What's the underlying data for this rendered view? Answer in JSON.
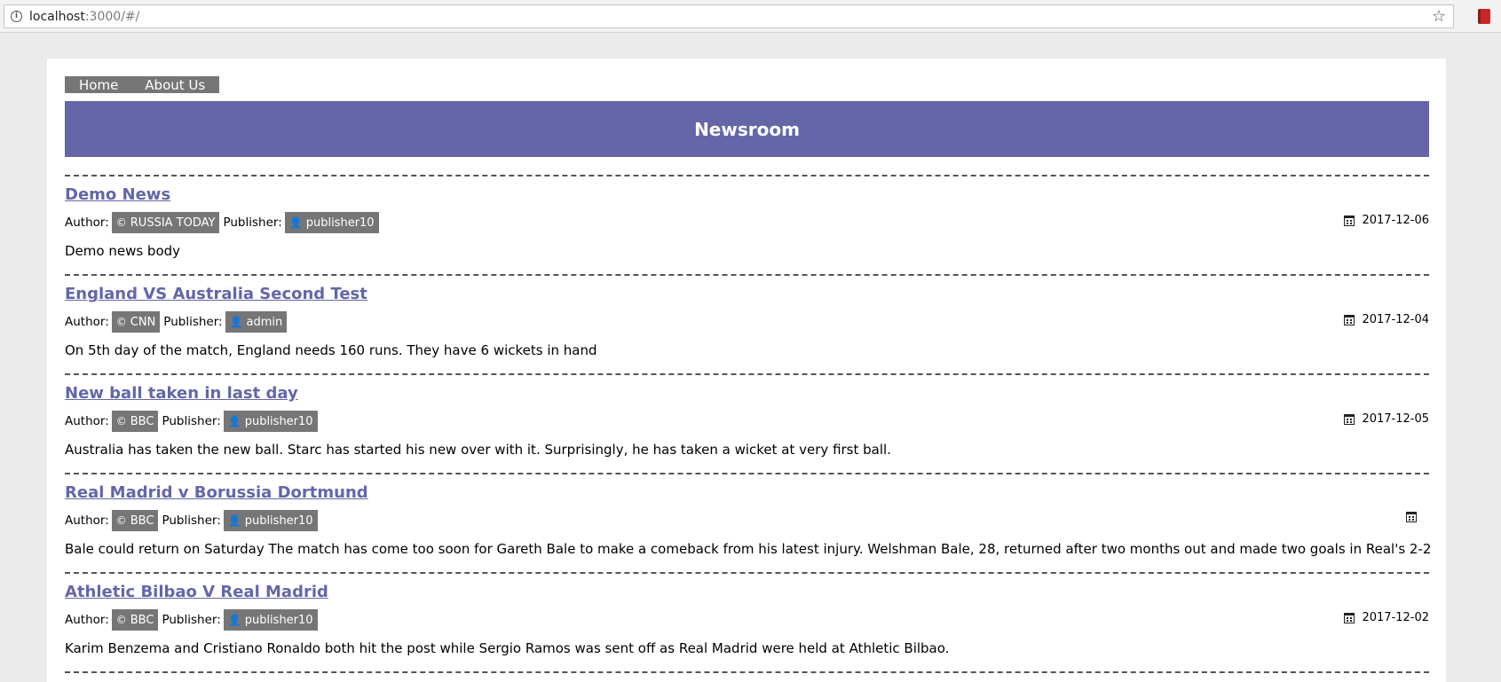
{
  "browser": {
    "url_host": "localhost",
    "url_rest": ":3000/#/"
  },
  "nav": {
    "items": [
      "Home",
      "About Us"
    ]
  },
  "banner": {
    "title": "Newsroom"
  },
  "labels": {
    "author": "Author:",
    "publisher": "Publisher:"
  },
  "news": [
    {
      "title": "Demo News",
      "author": "RUSSIA TODAY",
      "publisher": "publisher10",
      "date": "2017-12-06",
      "body": "Demo news body"
    },
    {
      "title": "England VS Australia Second Test",
      "author": "CNN",
      "publisher": "admin",
      "date": "2017-12-04",
      "body": "On 5th day of the match, England needs 160 runs. They have 6 wickets in hand"
    },
    {
      "title": "New ball taken in last day",
      "author": "BBC",
      "publisher": "publisher10",
      "date": "2017-12-05",
      "body": "Australia has taken the new ball. Starc has started his new over with it. Surprisingly, he has taken a wicket at very first ball."
    },
    {
      "title": "Real Madrid v Borussia Dortmund",
      "author": "BBC",
      "publisher": "publisher10",
      "date": "",
      "body": "Bale could return on Saturday The match has come too soon for Gareth Bale to make a comeback from his latest injury. Welshman Bale, 28, returned after two months out and made two goals in Real's 2-2"
    },
    {
      "title": "Athletic Bilbao V Real Madrid",
      "author": "BBC",
      "publisher": "publisher10",
      "date": "2017-12-02",
      "body": "Karim Benzema and Cristiano Ronaldo both hit the post while Sergio Ramos was sent off as Real Madrid were held at Athletic Bilbao."
    }
  ]
}
